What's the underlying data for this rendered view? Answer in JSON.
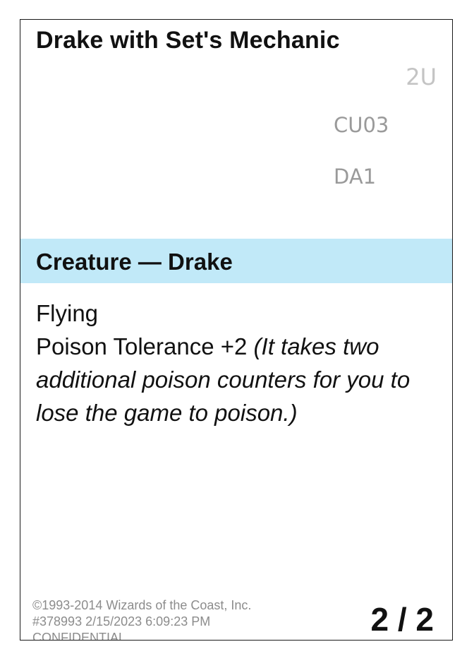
{
  "card": {
    "name": "Drake with Set's Mechanic",
    "mana_cost": "2U",
    "codes": [
      "CU03",
      "DA1"
    ],
    "type_line": "Creature — Drake",
    "type_bar_color": "#c1e9f8",
    "rules": {
      "keyword": "Flying",
      "ability": "Poison Tolerance +2",
      "reminder": "(It takes two additional poison counters for you to lose the game to poison.)"
    },
    "legal": {
      "copyright": "©1993-2014 Wizards of the Coast, Inc.",
      "id_line": "#378993 2/15/2023 6:09:23 PM",
      "confidential": "CONFIDENTIAL"
    },
    "power_toughness": "2 / 2"
  }
}
